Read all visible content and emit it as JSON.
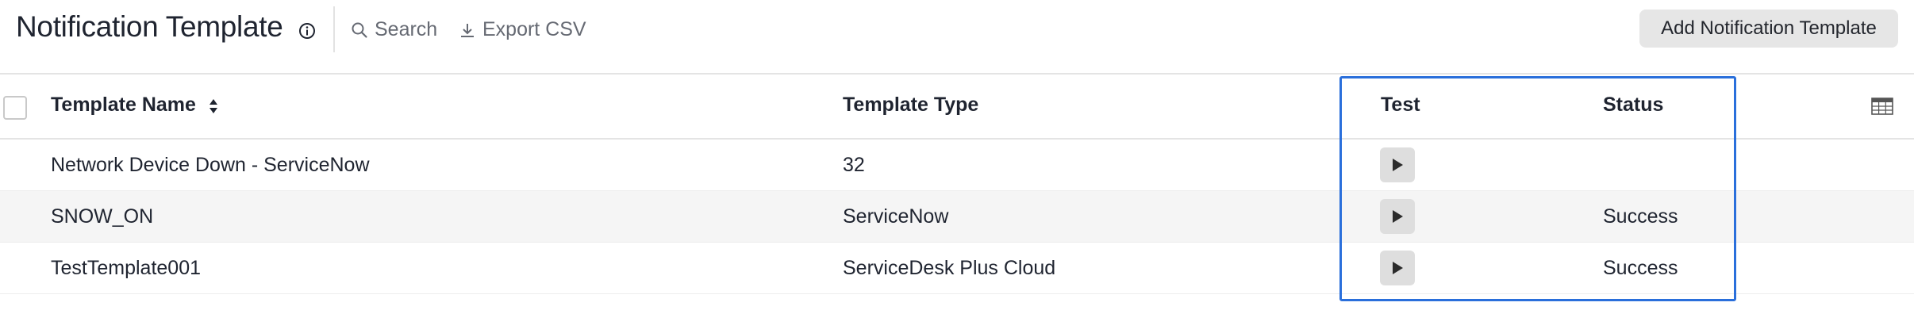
{
  "header": {
    "title": "Notification Template",
    "search_label": "Search",
    "export_label": "Export CSV",
    "add_button_label": "Add Notification Template"
  },
  "table": {
    "columns": [
      "Template Name",
      "Template Type",
      "Test",
      "Status"
    ],
    "rows": [
      {
        "name": "Network Device Down - ServiceNow",
        "type": "32",
        "status": ""
      },
      {
        "name": "SNOW_ON",
        "type": "ServiceNow",
        "status": "Success"
      },
      {
        "name": "TestTemplate001",
        "type": "ServiceDesk Plus Cloud",
        "status": "Success"
      }
    ]
  },
  "icons": {
    "info": "info-icon",
    "search": "search-icon",
    "export": "download-icon",
    "sort": "sort-icon",
    "play": "play-icon",
    "columns": "table-columns-icon"
  },
  "colors": {
    "highlight_border": "#2a6fdb",
    "button_bg": "#e6e6e6",
    "alt_row": "#f5f5f5"
  }
}
